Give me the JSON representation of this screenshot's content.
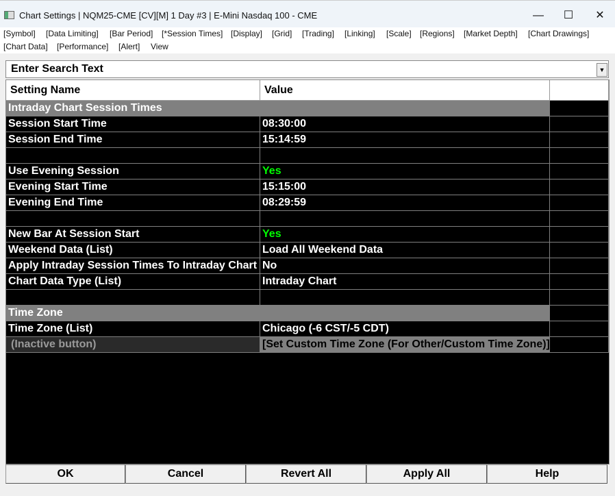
{
  "window": {
    "title": "Chart Settings | NQM25-CME [CV][M]  1 Day  #3 | E-Mini Nasdaq 100 - CME",
    "minimize": "—",
    "maximize": "☐",
    "close": "✕"
  },
  "menu": [
    "[Symbol]",
    "[Data Limiting]",
    "[Bar Period]",
    "[*Session Times]",
    "[Display]",
    "[Grid]",
    "[Trading]",
    "[Linking]",
    "[Scale]",
    "[Regions]",
    "[Market Depth]",
    "[Chart Drawings]",
    "[Chart Data]",
    "[Performance]",
    "[Alert]",
    "View"
  ],
  "search": {
    "placeholder": "Enter Search Text",
    "arrow": "▼"
  },
  "table": {
    "headers": [
      "Setting Name",
      "Value"
    ],
    "rows": [
      {
        "type": "section",
        "name": "Intraday Chart Session Times"
      },
      {
        "name": "Session Start Time",
        "value": "08:30:00"
      },
      {
        "name": "Session End Time",
        "value": "15:14:59"
      },
      {
        "type": "blank"
      },
      {
        "name": "Use Evening Session",
        "value": "Yes",
        "green": true
      },
      {
        "name": "Evening Start Time",
        "value": "15:15:00"
      },
      {
        "name": "Evening End Time",
        "value": "08:29:59"
      },
      {
        "type": "blank"
      },
      {
        "name": "New Bar At Session Start",
        "value": "Yes",
        "green": true
      },
      {
        "name": "Weekend Data (List)",
        "value": "Load All Weekend Data"
      },
      {
        "name": "Apply Intraday Session Times To Intraday Chart",
        "value": "No"
      },
      {
        "name": "Chart Data Type (List)",
        "value": "Intraday Chart"
      },
      {
        "type": "blank"
      },
      {
        "type": "section",
        "name": "Time Zone"
      },
      {
        "name": "Time Zone (List)",
        "value": "Chicago (-6 CST/-5 CDT)"
      },
      {
        "type": "inactive",
        "name": "(Inactive button)",
        "value": "[Set Custom Time Zone (For Other/Custom Time Zone)]"
      }
    ]
  },
  "buttons": {
    "ok": "OK",
    "cancel": "Cancel",
    "revert": "Revert All",
    "apply": "Apply All",
    "help": "Help"
  }
}
